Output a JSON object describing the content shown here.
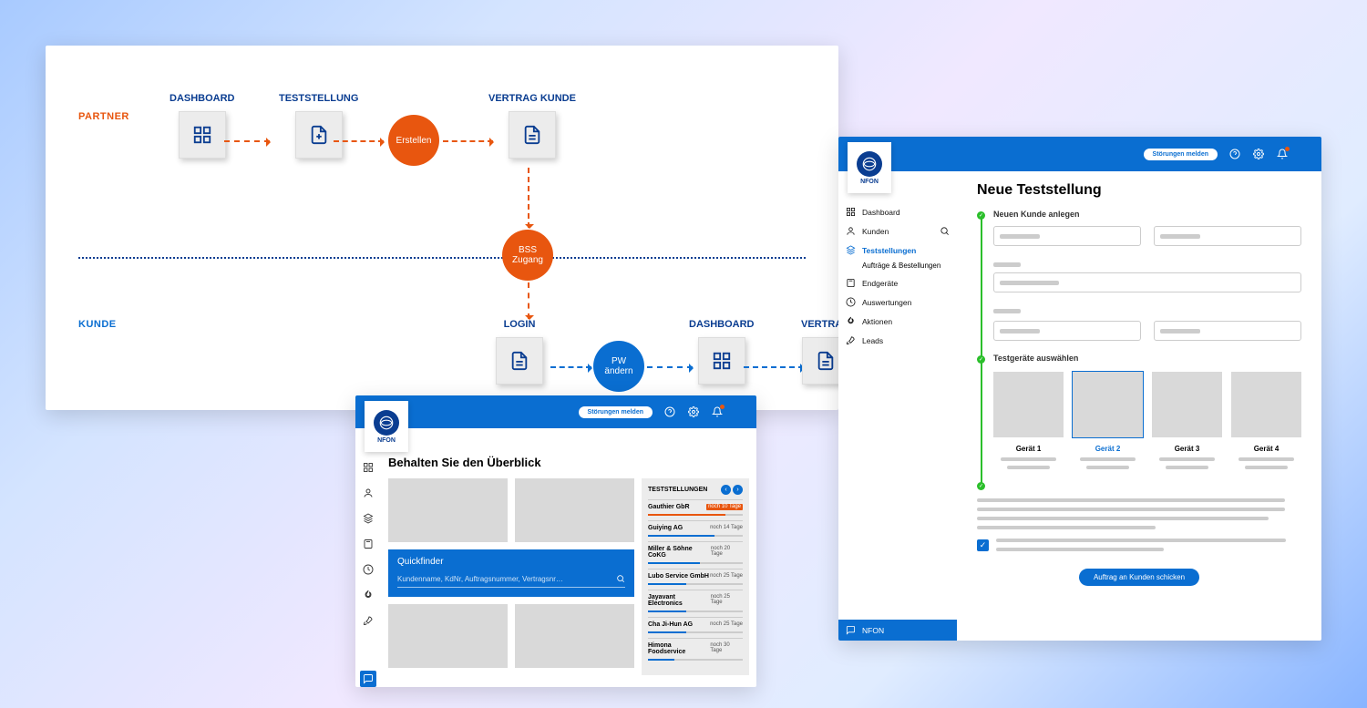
{
  "flow": {
    "partner_label": "PARTNER",
    "kunde_label": "KUNDE",
    "nodes": {
      "dashboard": "DASHBOARD",
      "teststellung": "TESTSTELLUNG",
      "vertrag_kunde": "VERTRAG KUNDE",
      "login": "LOGIN",
      "dashboard2": "DASHBOARD",
      "vertrag": "VERTRAG"
    },
    "circles": {
      "erstellen": "Erstellen",
      "bss": "BSS\nZugang",
      "pw": "PW\nändern"
    }
  },
  "brand": {
    "logo_text": "NFON"
  },
  "topbar": {
    "report": "Störungen melden"
  },
  "dashboard": {
    "title": "Behalten Sie den Überblick",
    "quickfinder": {
      "title": "Quickfinder",
      "placeholder": "Kundenname, KdNr, Auftragsnummer, Vertragsnr…"
    },
    "teststellungen": {
      "header": "TESTSTELLUNGEN",
      "rows": [
        {
          "name": "Gauthier GbR",
          "days": "noch 10 Tage",
          "urgent": true,
          "pct": 82
        },
        {
          "name": "Guiying AG",
          "days": "noch 14 Tage",
          "urgent": false,
          "pct": 70
        },
        {
          "name": "Miller & Söhne CoKG",
          "days": "noch 20 Tage",
          "urgent": false,
          "pct": 55
        },
        {
          "name": "Lubo Service GmbH",
          "days": "noch 25 Tage",
          "urgent": false,
          "pct": 40
        },
        {
          "name": "Jayavant Electronics",
          "days": "noch 25 Tage",
          "urgent": false,
          "pct": 40
        },
        {
          "name": "Cha Ji-Hun AG",
          "days": "noch 25 Tage",
          "urgent": false,
          "pct": 40
        },
        {
          "name": "Himona Foodservice",
          "days": "noch 30 Tage",
          "urgent": false,
          "pct": 28
        }
      ]
    }
  },
  "ts": {
    "title": "Neue Teststellung",
    "nav": {
      "dashboard": "Dashboard",
      "kunden": "Kunden",
      "teststellungen": "Teststellungen",
      "auftraege": "Aufträge & Bestellungen",
      "endgeraete": "Endgeräte",
      "auswertungen": "Auswertungen",
      "aktionen": "Aktionen",
      "leads": "Leads",
      "nfon": "NFON"
    },
    "steps": {
      "s1": "Neuen Kunde anlegen",
      "s2": "Testgeräte auswählen"
    },
    "devices": [
      {
        "name": "Gerät 1"
      },
      {
        "name": "Gerät 2"
      },
      {
        "name": "Gerät 3"
      },
      {
        "name": "Gerät 4"
      }
    ],
    "submit": "Auftrag an Kunden schicken"
  }
}
